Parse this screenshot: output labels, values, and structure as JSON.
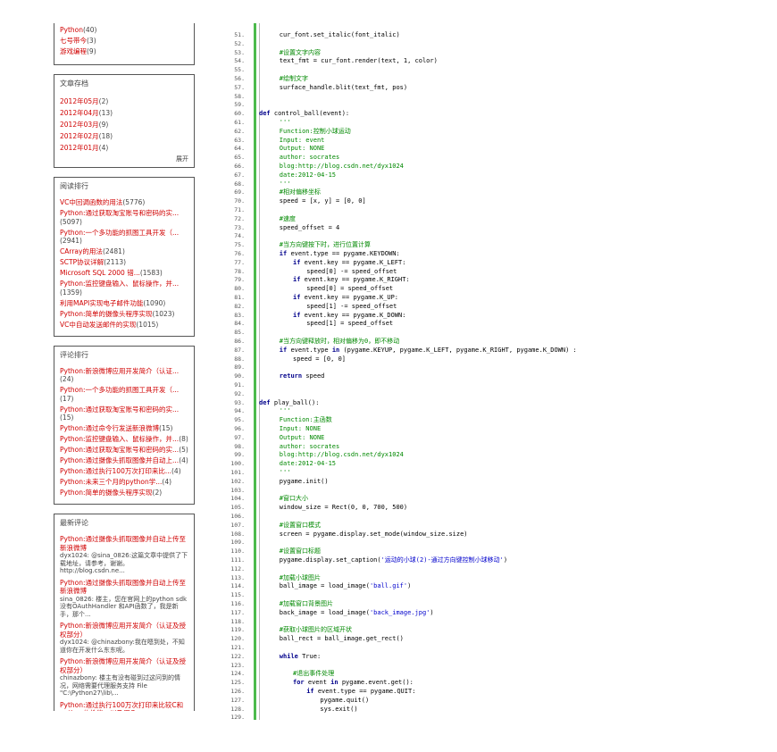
{
  "category_list": {
    "items": [
      {
        "label": "Python",
        "count": "(40)"
      },
      {
        "label": "七号带今",
        "count": "(3)"
      },
      {
        "label": "游戏编程",
        "count": "(9)"
      }
    ]
  },
  "archive": {
    "title": "文章存档",
    "items": [
      {
        "label": "2012年05月",
        "count": "(2)"
      },
      {
        "label": "2012年04月",
        "count": "(13)"
      },
      {
        "label": "2012年03月",
        "count": "(9)"
      },
      {
        "label": "2012年02月",
        "count": "(18)"
      },
      {
        "label": "2012年01月",
        "count": "(4)"
      }
    ],
    "expand_label": "展开"
  },
  "reading_rank": {
    "title": "阅读排行",
    "items": [
      {
        "label": "VC中回调函数的用法",
        "count": "(5776)"
      },
      {
        "label": "Python:通过获取淘宝账号和密码的实...",
        "count": "(5097)"
      },
      {
        "label": "Python:一个多功能的抓图工具开发（...",
        "count": "(2941)"
      },
      {
        "label": "CArray的用法",
        "count": "(2481)"
      },
      {
        "label": "SCTP协议详解",
        "count": "(2113)"
      },
      {
        "label": "Microsoft SQL 2000 错...",
        "count": "(1583)"
      },
      {
        "label": "Python:监控键盘输入、鼠标操作，并...",
        "count": "(1359)"
      },
      {
        "label": "利用MAPI实现电子邮件功能",
        "count": "(1090)"
      },
      {
        "label": "Python:简单的摄像头程序实现",
        "count": "(1023)"
      },
      {
        "label": "VC中自动发送邮件的实现",
        "count": "(1015)"
      }
    ]
  },
  "comment_rank": {
    "title": "评论排行",
    "items": [
      {
        "label": "Python:新浪微博应用开发简介（认证...",
        "count": "(24)"
      },
      {
        "label": "Python:一个多功能的抓图工具开发（...",
        "count": "(17)"
      },
      {
        "label": "Python:通过获取淘宝账号和密码的实...",
        "count": "(15)"
      },
      {
        "label": "Python:通过命令行发送新浪微博",
        "count": "(15)"
      },
      {
        "label": "Python:监控键盘输入、鼠标操作，并...",
        "count": "(8)"
      },
      {
        "label": "Python:通过获取淘宝账号和密码的实...",
        "count": "(5)"
      },
      {
        "label": "Python:通过摄像头抓取图像并自动上...",
        "count": "(4)"
      },
      {
        "label": "Python:通过执行100万次打印来比...",
        "count": "(4)"
      },
      {
        "label": "Python:未来三个月的python学...",
        "count": "(4)"
      },
      {
        "label": "Python:简单的摄像头程序实现",
        "count": "(2)"
      }
    ]
  },
  "latest_comments": {
    "title": "最新评论",
    "items": [
      {
        "link": "Python:通过摄像头抓取图像并自动上传至新浪微博",
        "text": "dyx1024: @sina_0826:这篇文章中提供了下载地址，请参考，谢谢。http://blog.csdn.ne..."
      },
      {
        "link": "Python:通过摄像头抓取图像并自动上传至新浪微博",
        "text": "sina_0826: 楼主，您在官网上的python sdk没有OAuthHandler 和API函数了，我是新手，那个..."
      },
      {
        "link": "Python:新浪微博应用开发简介（认证及授权部分）",
        "text": "dyx1024: @chinazbony:我在嗯到处，不知道你在开发什么东东呢。"
      },
      {
        "link": "Python:新浪微博应用开发简介（认证及授权部分）",
        "text": "chinazbony: 楼主有没有碰到过这问到的情况，网络需要代理服务支持 File \"C:\\Python27\\lib\\..."
      },
      {
        "link": "Python:通过执行100万次打印来比较C和python的性能，以及用C",
        "text": ""
      }
    ]
  },
  "code": {
    "lines": [
      {
        "n": "51.",
        "indent": 3,
        "parts": [
          [
            "",
            "cur_font.set_italic(font_italic)"
          ]
        ]
      },
      {
        "n": "52.",
        "indent": 0,
        "parts": []
      },
      {
        "n": "53.",
        "indent": 3,
        "parts": [
          [
            "cm",
            "#设置文字内容"
          ]
        ]
      },
      {
        "n": "54.",
        "indent": 3,
        "parts": [
          [
            "",
            "text_fmt = cur_font.render(text, 1, color)"
          ]
        ]
      },
      {
        "n": "55.",
        "indent": 0,
        "parts": []
      },
      {
        "n": "56.",
        "indent": 3,
        "parts": [
          [
            "cm",
            "#绘制文字"
          ]
        ]
      },
      {
        "n": "57.",
        "indent": 3,
        "parts": [
          [
            "",
            "surface_handle.blit(text_fmt, pos)"
          ]
        ]
      },
      {
        "n": "58.",
        "indent": 0,
        "parts": []
      },
      {
        "n": "59.",
        "indent": 0,
        "parts": []
      },
      {
        "n": "60.",
        "indent": 0,
        "parts": [
          [
            "def",
            "def "
          ],
          [
            "",
            "control_ball(event):"
          ]
        ]
      },
      {
        "n": "61.",
        "indent": 3,
        "parts": [
          [
            "cm",
            "'''"
          ]
        ]
      },
      {
        "n": "62.",
        "indent": 3,
        "parts": [
          [
            "cm",
            "Function:控制小球运动"
          ]
        ]
      },
      {
        "n": "63.",
        "indent": 3,
        "parts": [
          [
            "cm",
            "Input: event"
          ]
        ]
      },
      {
        "n": "64.",
        "indent": 3,
        "parts": [
          [
            "cm",
            "Output: NONE"
          ]
        ]
      },
      {
        "n": "65.",
        "indent": 3,
        "parts": [
          [
            "cm",
            "author: socrates"
          ]
        ]
      },
      {
        "n": "66.",
        "indent": 3,
        "parts": [
          [
            "cm",
            "blog:http://blog.csdn.net/dyx1024"
          ]
        ]
      },
      {
        "n": "67.",
        "indent": 3,
        "parts": [
          [
            "cm",
            "date:2012-04-15"
          ]
        ]
      },
      {
        "n": "68.",
        "indent": 3,
        "parts": [
          [
            "cm",
            "'''"
          ]
        ]
      },
      {
        "n": "69.",
        "indent": 3,
        "parts": [
          [
            "cm",
            "#相对偏移坐标"
          ]
        ]
      },
      {
        "n": "70.",
        "indent": 3,
        "parts": [
          [
            "",
            "speed = [x, y] = [0, 0]"
          ]
        ]
      },
      {
        "n": "71.",
        "indent": 0,
        "parts": []
      },
      {
        "n": "72.",
        "indent": 3,
        "parts": [
          [
            "cm",
            "#速度"
          ]
        ]
      },
      {
        "n": "73.",
        "indent": 3,
        "parts": [
          [
            "",
            "speed_offset = 4"
          ]
        ]
      },
      {
        "n": "74.",
        "indent": 0,
        "parts": []
      },
      {
        "n": "75.",
        "indent": 3,
        "parts": [
          [
            "cm",
            "#当方向键按下时，进行位置计算"
          ]
        ]
      },
      {
        "n": "76.",
        "indent": 3,
        "parts": [
          [
            "kw",
            "if "
          ],
          [
            "",
            "event.type == pygame.KEYDOWN:"
          ]
        ]
      },
      {
        "n": "77.",
        "indent": 5,
        "parts": [
          [
            "kw",
            "if "
          ],
          [
            "",
            "event.key == pygame.K_LEFT:"
          ]
        ]
      },
      {
        "n": "78.",
        "indent": 7,
        "parts": [
          [
            "",
            "speed[0] -= speed_offset"
          ]
        ]
      },
      {
        "n": "79.",
        "indent": 5,
        "parts": [
          [
            "kw",
            "if "
          ],
          [
            "",
            "event.key == pygame.K_RIGHT:"
          ]
        ]
      },
      {
        "n": "80.",
        "indent": 7,
        "parts": [
          [
            "",
            "speed[0] = speed_offset"
          ]
        ]
      },
      {
        "n": "81.",
        "indent": 5,
        "parts": [
          [
            "kw",
            "if "
          ],
          [
            "",
            "event.key == pygame.K_UP:"
          ]
        ]
      },
      {
        "n": "82.",
        "indent": 7,
        "parts": [
          [
            "",
            "speed[1] -= speed_offset"
          ]
        ]
      },
      {
        "n": "83.",
        "indent": 5,
        "parts": [
          [
            "kw",
            "if "
          ],
          [
            "",
            "event.key == pygame.K_DOWN:"
          ]
        ]
      },
      {
        "n": "84.",
        "indent": 7,
        "parts": [
          [
            "",
            "speed[1] = speed_offset"
          ]
        ]
      },
      {
        "n": "85.",
        "indent": 0,
        "parts": []
      },
      {
        "n": "86.",
        "indent": 3,
        "parts": [
          [
            "cm",
            "#当方向键释放时，相对偏移为0，即不移动"
          ]
        ]
      },
      {
        "n": "87.",
        "indent": 3,
        "parts": [
          [
            "kw",
            "if "
          ],
          [
            "",
            "event.type "
          ],
          [
            "kw",
            "in "
          ],
          [
            "",
            "(pygame.KEYUP, pygame.K_LEFT, pygame.K_RIGHT, pygame.K_DOWN) :"
          ]
        ]
      },
      {
        "n": "88.",
        "indent": 5,
        "parts": [
          [
            "",
            "speed = [0, 0]"
          ]
        ]
      },
      {
        "n": "89.",
        "indent": 0,
        "parts": []
      },
      {
        "n": "90.",
        "indent": 3,
        "parts": [
          [
            "kw",
            "return "
          ],
          [
            "",
            "speed"
          ]
        ]
      },
      {
        "n": "91.",
        "indent": 0,
        "parts": []
      },
      {
        "n": "92.",
        "indent": 0,
        "parts": []
      },
      {
        "n": "93.",
        "indent": 0,
        "parts": [
          [
            "def",
            "def "
          ],
          [
            "",
            "play_ball():"
          ]
        ]
      },
      {
        "n": "94.",
        "indent": 3,
        "parts": [
          [
            "cm",
            "'''"
          ]
        ]
      },
      {
        "n": "95.",
        "indent": 3,
        "parts": [
          [
            "cm",
            "Function:主函数"
          ]
        ]
      },
      {
        "n": "96.",
        "indent": 3,
        "parts": [
          [
            "cm",
            "Input: NONE"
          ]
        ]
      },
      {
        "n": "97.",
        "indent": 3,
        "parts": [
          [
            "cm",
            "Output: NONE"
          ]
        ]
      },
      {
        "n": "98.",
        "indent": 3,
        "parts": [
          [
            "cm",
            "author: socrates"
          ]
        ]
      },
      {
        "n": "99.",
        "indent": 3,
        "parts": [
          [
            "cm",
            "blog:http://blog.csdn.net/dyx1024"
          ]
        ]
      },
      {
        "n": "100.",
        "indent": 3,
        "parts": [
          [
            "cm",
            "date:2012-04-15"
          ]
        ]
      },
      {
        "n": "101.",
        "indent": 3,
        "parts": [
          [
            "cm",
            "'''"
          ]
        ]
      },
      {
        "n": "102.",
        "indent": 3,
        "parts": [
          [
            "",
            "pygame.init()"
          ]
        ]
      },
      {
        "n": "103.",
        "indent": 0,
        "parts": []
      },
      {
        "n": "104.",
        "indent": 3,
        "parts": [
          [
            "cm",
            "#窗口大小"
          ]
        ]
      },
      {
        "n": "105.",
        "indent": 3,
        "parts": [
          [
            "",
            "window_size = Rect(0, 0, 700, 500)"
          ]
        ]
      },
      {
        "n": "106.",
        "indent": 0,
        "parts": []
      },
      {
        "n": "107.",
        "indent": 3,
        "parts": [
          [
            "cm",
            "#设置窗口模式"
          ]
        ]
      },
      {
        "n": "108.",
        "indent": 3,
        "parts": [
          [
            "",
            "screen = pygame.display.set_mode(window_size.size)"
          ]
        ]
      },
      {
        "n": "109.",
        "indent": 0,
        "parts": []
      },
      {
        "n": "110.",
        "indent": 3,
        "parts": [
          [
            "cm",
            "#设置窗口标题"
          ]
        ]
      },
      {
        "n": "111.",
        "indent": 3,
        "parts": [
          [
            "",
            "pygame.display.set_caption("
          ],
          [
            "st",
            "'运动的小球(2)-通过方向键控制小球移动'"
          ],
          [
            "",
            ")"
          ]
        ]
      },
      {
        "n": "112.",
        "indent": 0,
        "parts": []
      },
      {
        "n": "113.",
        "indent": 3,
        "parts": [
          [
            "cm",
            "#加载小球图片"
          ]
        ]
      },
      {
        "n": "114.",
        "indent": 3,
        "parts": [
          [
            "",
            "ball_image = load_image("
          ],
          [
            "st",
            "'ball.gif'"
          ],
          [
            "",
            ")"
          ]
        ]
      },
      {
        "n": "115.",
        "indent": 0,
        "parts": []
      },
      {
        "n": "116.",
        "indent": 3,
        "parts": [
          [
            "cm",
            "#加载窗口背景图片"
          ]
        ]
      },
      {
        "n": "117.",
        "indent": 3,
        "parts": [
          [
            "",
            "back_image = load_image("
          ],
          [
            "st",
            "'back_image.jpg'"
          ],
          [
            "",
            ")"
          ]
        ]
      },
      {
        "n": "118.",
        "indent": 0,
        "parts": []
      },
      {
        "n": "119.",
        "indent": 3,
        "parts": [
          [
            "cm",
            "#获取小球图片的区域开状"
          ]
        ]
      },
      {
        "n": "120.",
        "indent": 3,
        "parts": [
          [
            "",
            "ball_rect = ball_image.get_rect()"
          ]
        ]
      },
      {
        "n": "121.",
        "indent": 0,
        "parts": []
      },
      {
        "n": "122.",
        "indent": 3,
        "parts": [
          [
            "kw",
            "while "
          ],
          [
            "",
            "True:"
          ]
        ]
      },
      {
        "n": "123.",
        "indent": 0,
        "parts": []
      },
      {
        "n": "124.",
        "indent": 5,
        "parts": [
          [
            "cm",
            "#退出事件处理"
          ]
        ]
      },
      {
        "n": "125.",
        "indent": 5,
        "parts": [
          [
            "kw",
            "for "
          ],
          [
            "",
            "event "
          ],
          [
            "kw",
            "in "
          ],
          [
            "",
            "pygame.event.get():"
          ]
        ]
      },
      {
        "n": "126.",
        "indent": 7,
        "parts": [
          [
            "kw",
            "if "
          ],
          [
            "",
            "event.type == pygame.QUIT:"
          ]
        ]
      },
      {
        "n": "127.",
        "indent": 9,
        "parts": [
          [
            "",
            "pygame.quit()"
          ]
        ]
      },
      {
        "n": "128.",
        "indent": 9,
        "parts": [
          [
            "",
            "sys.exit()"
          ]
        ]
      },
      {
        "n": "129.",
        "indent": 0,
        "parts": []
      }
    ]
  }
}
